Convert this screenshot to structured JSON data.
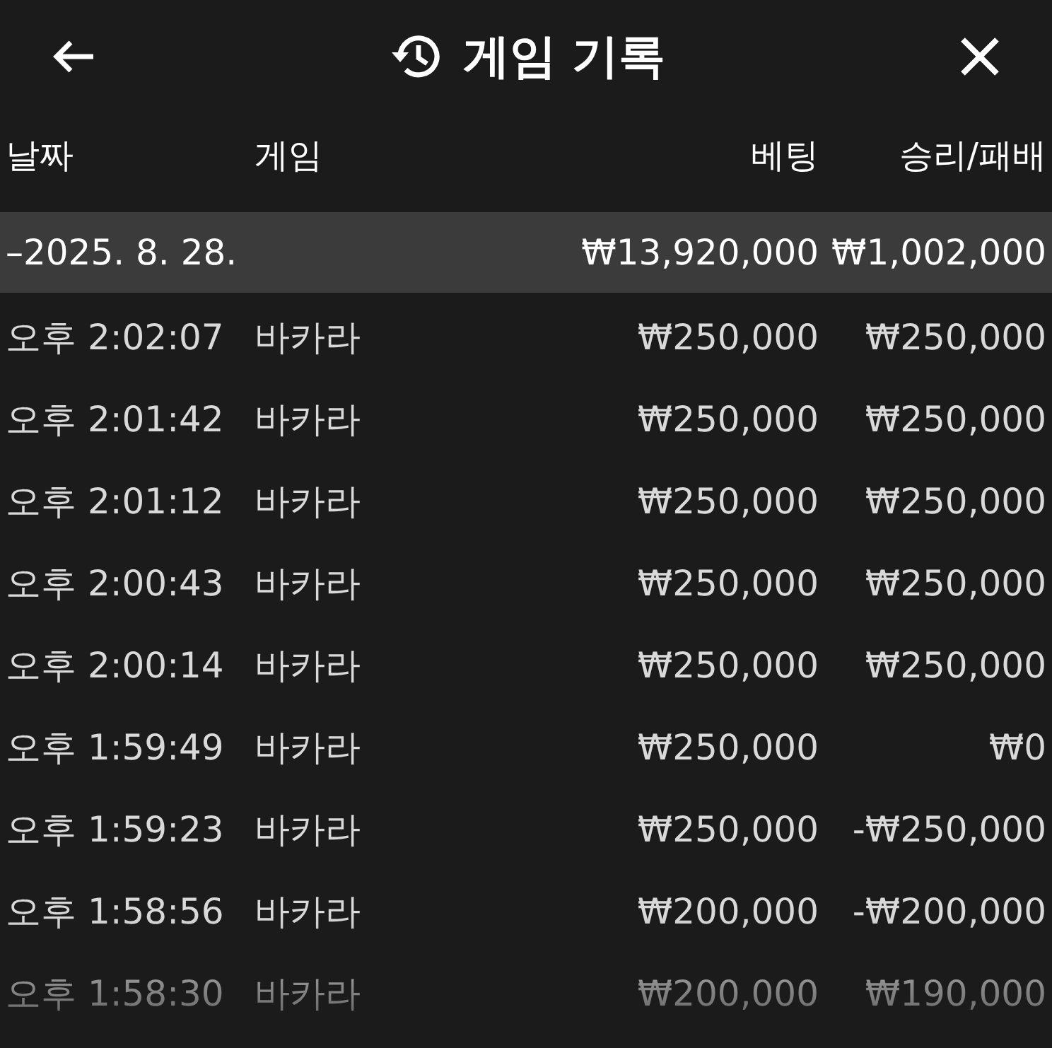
{
  "header": {
    "title": "게임 기록"
  },
  "columns": [
    "날짜",
    "게임",
    "베팅",
    "승리/패배"
  ],
  "group": {
    "date": "–2025. 8. 28.",
    "bet": "₩13,920,000",
    "result": "₩1,002,000"
  },
  "rows": [
    {
      "time": "오후 2:02:07",
      "game": "바카라",
      "bet": "₩250,000",
      "result": "₩250,000"
    },
    {
      "time": "오후 2:01:42",
      "game": "바카라",
      "bet": "₩250,000",
      "result": "₩250,000"
    },
    {
      "time": "오후 2:01:12",
      "game": "바카라",
      "bet": "₩250,000",
      "result": "₩250,000"
    },
    {
      "time": "오후 2:00:43",
      "game": "바카라",
      "bet": "₩250,000",
      "result": "₩250,000"
    },
    {
      "time": "오후 2:00:14",
      "game": "바카라",
      "bet": "₩250,000",
      "result": "₩250,000"
    },
    {
      "time": "오후 1:59:49",
      "game": "바카라",
      "bet": "₩250,000",
      "result": "₩0"
    },
    {
      "time": "오후 1:59:23",
      "game": "바카라",
      "bet": "₩250,000",
      "result": "-₩250,000"
    },
    {
      "time": "오후 1:58:56",
      "game": "바카라",
      "bet": "₩200,000",
      "result": "-₩200,000"
    },
    {
      "time": "오후 1:58:30",
      "game": "바카라",
      "bet": "₩200,000",
      "result": "₩190,000"
    }
  ]
}
